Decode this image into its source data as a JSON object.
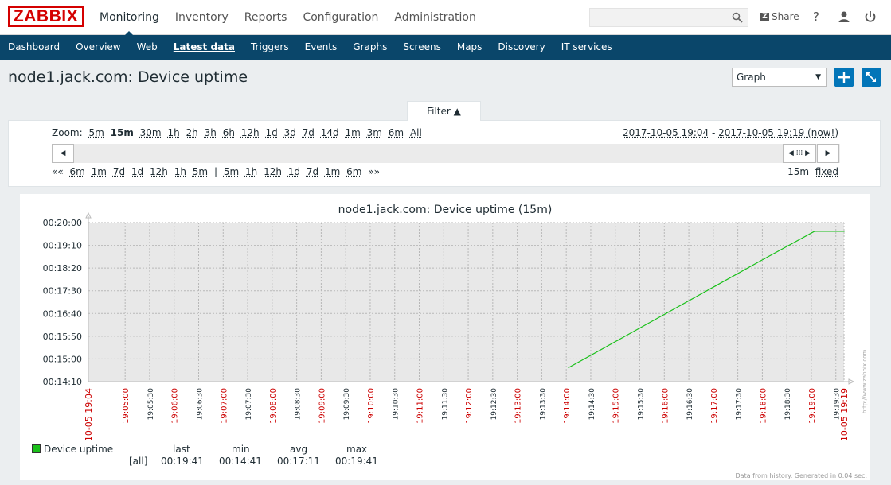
{
  "brand": {
    "logo_text": "ZABBIX",
    "accent": "#d40000",
    "nav_bg": "#0a466a",
    "button_blue": "#0275b8"
  },
  "topnav": [
    {
      "label": "Monitoring",
      "active": true
    },
    {
      "label": "Inventory"
    },
    {
      "label": "Reports"
    },
    {
      "label": "Configuration"
    },
    {
      "label": "Administration"
    }
  ],
  "header": {
    "share_label": "Share",
    "help_icon": "help-icon",
    "user_icon": "user-icon",
    "signout_icon": "power-icon",
    "search_placeholder": ""
  },
  "subnav": [
    {
      "label": "Dashboard"
    },
    {
      "label": "Overview"
    },
    {
      "label": "Web"
    },
    {
      "label": "Latest data",
      "active": true
    },
    {
      "label": "Triggers"
    },
    {
      "label": "Events"
    },
    {
      "label": "Graphs"
    },
    {
      "label": "Screens"
    },
    {
      "label": "Maps"
    },
    {
      "label": "Discovery"
    },
    {
      "label": "IT services"
    }
  ],
  "page": {
    "title": "node1.jack.com: Device uptime",
    "view_select": "Graph"
  },
  "filter": {
    "tab_label": "Filter ▲",
    "zoom_label": "Zoom:",
    "zoom_options": [
      "5m",
      "15m",
      "30m",
      "1h",
      "2h",
      "3h",
      "6h",
      "12h",
      "1d",
      "3d",
      "7d",
      "14d",
      "1m",
      "3m",
      "6m",
      "All"
    ],
    "zoom_selected": "15m",
    "range_from": "2017-10-05 19:04",
    "range_sep": " - ",
    "range_to": "2017-10-05 19:19 (now!)",
    "back_arrows": "««",
    "back_options": [
      "6m",
      "1m",
      "7d",
      "1d",
      "12h",
      "1h",
      "5m"
    ],
    "separator": "|",
    "fwd_options": [
      "5m",
      "1h",
      "12h",
      "1d",
      "7d",
      "1m",
      "6m"
    ],
    "fwd_arrows": "»»",
    "period": "15m",
    "fixed": "fixed"
  },
  "chart_data": {
    "type": "line",
    "title": "node1.jack.com: Device uptime (15m)",
    "y_ticks": [
      "00:14:10",
      "00:15:00",
      "00:15:50",
      "00:16:40",
      "00:17:30",
      "00:18:20",
      "00:19:10",
      "00:20:00"
    ],
    "ylim_seconds": [
      850,
      1200
    ],
    "x_ticks": [
      {
        "label": "10-05 19:04",
        "major": true
      },
      {
        "label": "19:05:00",
        "major": true
      },
      {
        "label": "19:05:30",
        "major": false
      },
      {
        "label": "19:06:00",
        "major": true
      },
      {
        "label": "19:06:30",
        "major": false
      },
      {
        "label": "19:07:00",
        "major": true
      },
      {
        "label": "19:07:30",
        "major": false
      },
      {
        "label": "19:08:00",
        "major": true
      },
      {
        "label": "19:08:30",
        "major": false
      },
      {
        "label": "19:09:00",
        "major": true
      },
      {
        "label": "19:09:30",
        "major": false
      },
      {
        "label": "19:10:00",
        "major": true
      },
      {
        "label": "19:10:30",
        "major": false
      },
      {
        "label": "19:11:00",
        "major": true
      },
      {
        "label": "19:11:30",
        "major": false
      },
      {
        "label": "19:12:00",
        "major": true
      },
      {
        "label": "19:12:30",
        "major": false
      },
      {
        "label": "19:13:00",
        "major": true
      },
      {
        "label": "19:13:30",
        "major": false
      },
      {
        "label": "19:14:00",
        "major": true
      },
      {
        "label": "19:14:30",
        "major": false
      },
      {
        "label": "19:15:00",
        "major": true
      },
      {
        "label": "19:15:30",
        "major": false
      },
      {
        "label": "19:16:00",
        "major": true
      },
      {
        "label": "19:16:30",
        "major": false
      },
      {
        "label": "19:17:00",
        "major": true
      },
      {
        "label": "19:17:30",
        "major": false
      },
      {
        "label": "19:18:00",
        "major": true
      },
      {
        "label": "19:18:30",
        "major": false
      },
      {
        "label": "19:19:00",
        "major": true
      },
      {
        "label": "19:19:30",
        "major": false
      },
      {
        "label": "10-05 19:19",
        "major": true
      }
    ],
    "series": [
      {
        "name": "Device uptime",
        "color": "#1ac01a",
        "x": [
          "19:14:03",
          "19:15:03",
          "19:16:03",
          "19:17:03",
          "19:18:03",
          "19:19:04",
          "19:19:40"
        ],
        "y_seconds": [
          881,
          941,
          1001,
          1061,
          1121,
          1181,
          1181
        ]
      }
    ],
    "legend": {
      "name": "Device uptime",
      "scope": "[all]",
      "headers": [
        "last",
        "min",
        "avg",
        "max"
      ],
      "values": [
        "00:19:41",
        "00:14:41",
        "00:17:11",
        "00:19:41"
      ]
    },
    "watermark": "http://www.zabbix.com",
    "footer_note": "Data from history. Generated in 0.04 sec."
  }
}
